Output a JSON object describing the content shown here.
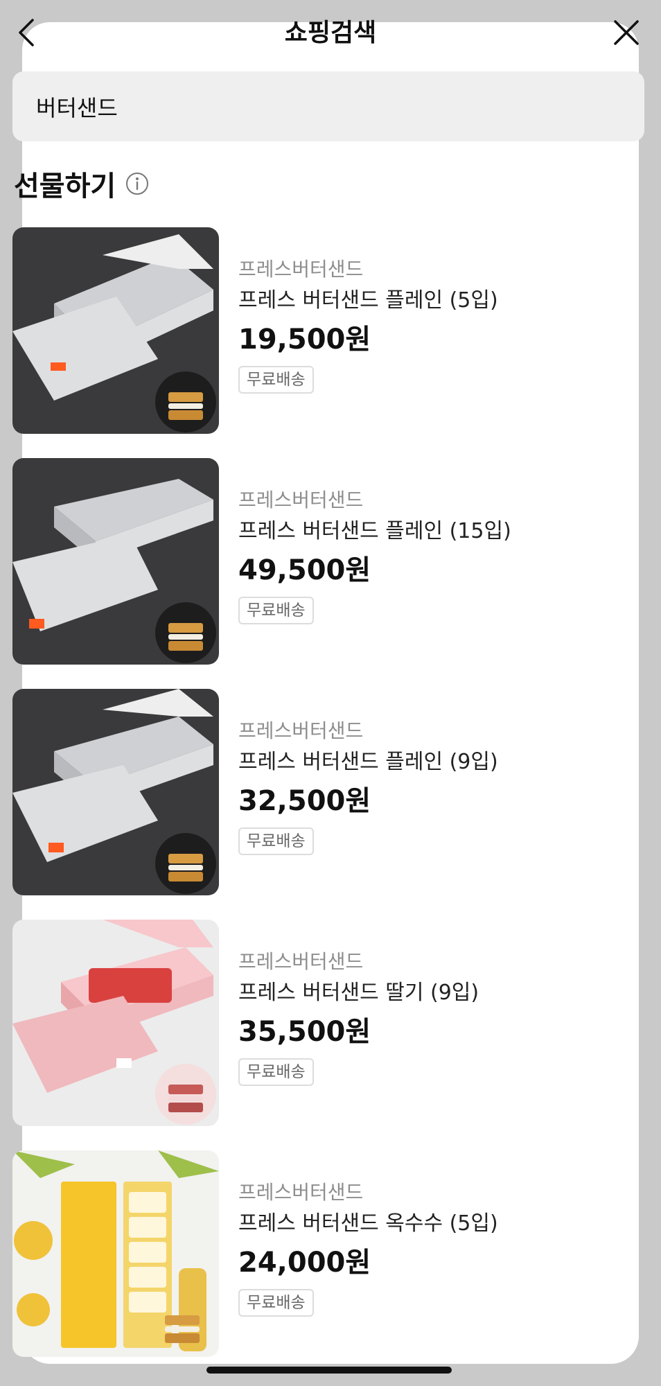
{
  "header": {
    "title": "쇼핑검색"
  },
  "search": {
    "value": "버터샌드"
  },
  "section": {
    "title": "선물하기"
  },
  "products": [
    {
      "brand": "프레스버터샌드",
      "name": "프레스 버터샌드 플레인 (5입)",
      "price": "19,500원",
      "badge": "무료배송",
      "box_color": "#dedfe1",
      "bg_color": "#3a3a3c"
    },
    {
      "brand": "프레스버터샌드",
      "name": "프레스 버터샌드 플레인 (15입)",
      "price": "49,500원",
      "badge": "무료배송",
      "box_color": "#dedfe1",
      "bg_color": "#3a3a3c"
    },
    {
      "brand": "프레스버터샌드",
      "name": "프레스 버터샌드 플레인 (9입)",
      "price": "32,500원",
      "badge": "무료배송",
      "box_color": "#dedfe1",
      "bg_color": "#3a3a3c"
    },
    {
      "brand": "프레스버터샌드",
      "name": "프레스 버터샌드 딸기 (9입)",
      "price": "35,500원",
      "badge": "무료배송",
      "box_color": "#f0b9bd",
      "bg_color": "#ececec"
    },
    {
      "brand": "프레스버터샌드",
      "name": "프레스 버터샌드 옥수수 (5입)",
      "price": "24,000원",
      "badge": "무료배송",
      "box_color": "#f5c52a",
      "bg_color": "#f2f2ef"
    }
  ]
}
